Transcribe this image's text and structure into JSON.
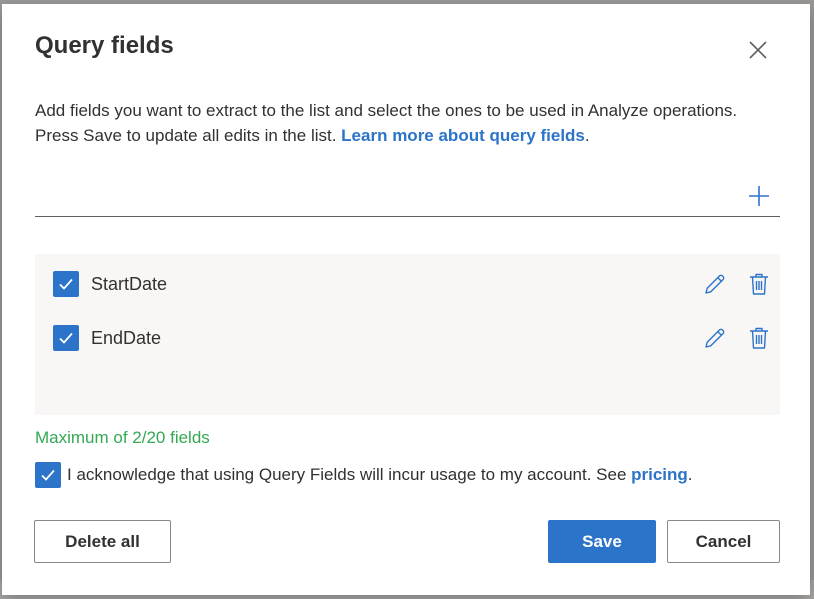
{
  "dialog": {
    "title": "Query fields",
    "description": "Add fields you want to extract to the list and select the ones to be used in Analyze operations. Press Save to update all edits in the list. ",
    "learn_more_link": "Learn more about query fields",
    "description_end": ".",
    "field_input": {
      "value": "",
      "placeholder": ""
    },
    "fields": [
      {
        "label": "StartDate",
        "checked": true
      },
      {
        "label": "EndDate",
        "checked": true
      }
    ],
    "count_text": "Maximum of 2/20 fields",
    "acknowledge": {
      "text": "I acknowledge that using Query Fields will incur usage to my account. See ",
      "link": "pricing",
      "end": ".",
      "checked": true
    },
    "buttons": {
      "delete_all": "Delete all",
      "save": "Save",
      "cancel": "Cancel"
    }
  },
  "icons": {
    "close": "close-icon",
    "add": "add-icon",
    "edit": "pencil-icon",
    "delete": "trash-icon",
    "check": "checkmark-icon"
  },
  "colors": {
    "accent": "#2b74c9",
    "success": "#34a853",
    "text": "#323130",
    "list_bg": "#f8f7f6"
  }
}
